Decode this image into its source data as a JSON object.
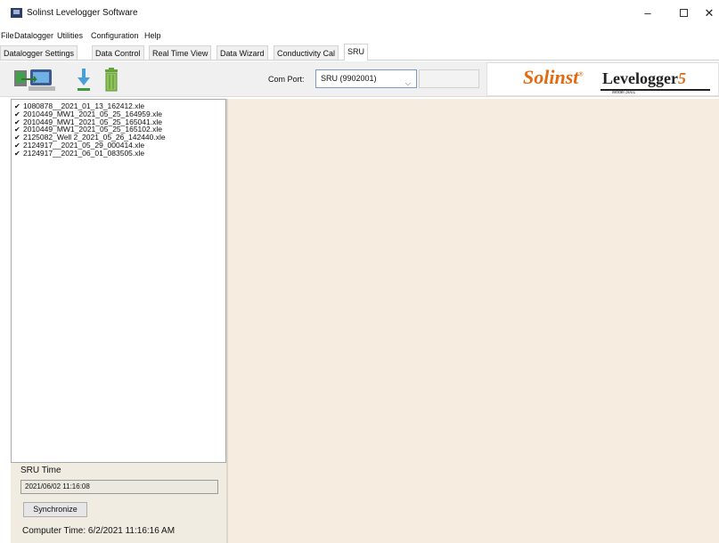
{
  "window": {
    "title": "Solinst Levelogger Software",
    "minimize_glyph": "–",
    "close_glyph": "✕"
  },
  "menu": [
    "File",
    "Datalogger",
    "Utilities",
    "Configuration",
    "Help"
  ],
  "tabs": [
    {
      "label": "Datalogger Settings",
      "active": false
    },
    {
      "label": "Data Control",
      "active": false
    },
    {
      "label": "Real Time View",
      "active": false
    },
    {
      "label": "Data Wizard",
      "active": false
    },
    {
      "label": "Conductivity Cal",
      "active": false
    },
    {
      "label": "SRU",
      "active": true
    }
  ],
  "toolbar": {
    "icons": [
      "computer-transfer-icon",
      "download-arrow-icon",
      "trash-icon"
    ],
    "com_port_label": "Com Port:",
    "com_port_value": "SRU (9902001)",
    "dropdown_glyph": "⌵"
  },
  "brand": {
    "solinst": "Solinst",
    "registered": "®",
    "product": "Levelogger",
    "product_suffix": "5",
    "model": "Model 3001",
    "solinst_color": "#e2690f"
  },
  "files": [
    {
      "name": "1080878__2021_01_13_162412.xle",
      "checked": true
    },
    {
      "name": "2010449_MW1_2021_05_25_164959.xle",
      "checked": true
    },
    {
      "name": "2010449_MW1_2021_05_25_165041.xle",
      "checked": true
    },
    {
      "name": "2010449_MW1_2021_05_25_165102.xle",
      "checked": true
    },
    {
      "name": "2125082_Well 2_2021_05_26_142440.xle",
      "checked": true
    },
    {
      "name": "2124917__2021_05_29_000414.xle",
      "checked": true
    },
    {
      "name": "2124917__2021_06_01_083505.xle",
      "checked": true
    }
  ],
  "check_glyph": "✔",
  "sru_panel": {
    "sru_time_label": "SRU Time",
    "sru_time_value": "2021/06/02 11:16:08",
    "synchronize_label": "Synchronize",
    "computer_time": "Computer Time: 6/2/2021 11:16:16 AM"
  },
  "colors": {
    "main_background": "#f6ecdf",
    "panel_background": "#f0ece2"
  }
}
